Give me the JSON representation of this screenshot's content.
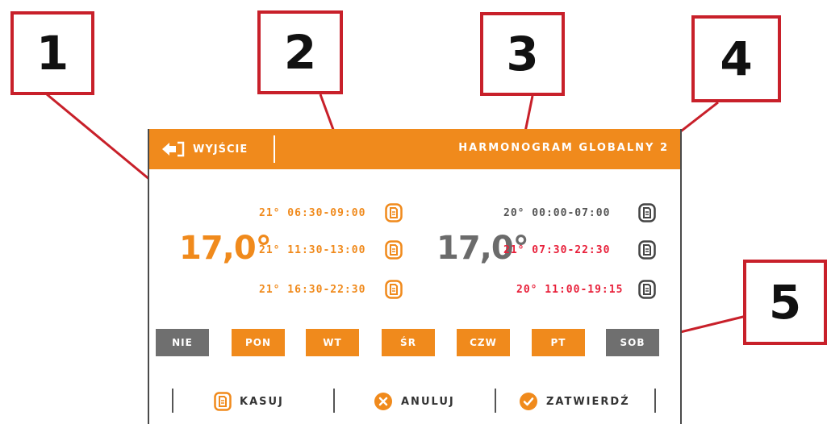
{
  "callouts": [
    "1",
    "2",
    "3",
    "4",
    "5"
  ],
  "header": {
    "exit_label": "WYJŚCIE",
    "title": "HARMONOGRAM GLOBALNY 2"
  },
  "left_schedule": {
    "temperature": "17,0°",
    "periods": [
      "21° 06:30-09:00",
      "21° 11:30-13:00",
      "21° 16:30-22:30"
    ]
  },
  "right_schedule": {
    "temperature": "17,0°",
    "periods": [
      "20° 00:00-07:00",
      "21° 07:30-22:30",
      "20° 11:00-19:15"
    ]
  },
  "days": [
    {
      "label": "NIE",
      "active": false
    },
    {
      "label": "PON",
      "active": true
    },
    {
      "label": "WT",
      "active": true
    },
    {
      "label": "ŚR",
      "active": true
    },
    {
      "label": "CZW",
      "active": true
    },
    {
      "label": "PT",
      "active": true
    },
    {
      "label": "SOB",
      "active": false
    }
  ],
  "actions": {
    "delete": "KASUJ",
    "cancel": "ANULUJ",
    "confirm": "ZATWIERDŹ"
  },
  "colors": {
    "orange": "#f08a1c",
    "red": "#e8203a",
    "gray_text": "#555555",
    "inactive_day": "#6f6f6f",
    "callout_border": "#c8202a"
  }
}
